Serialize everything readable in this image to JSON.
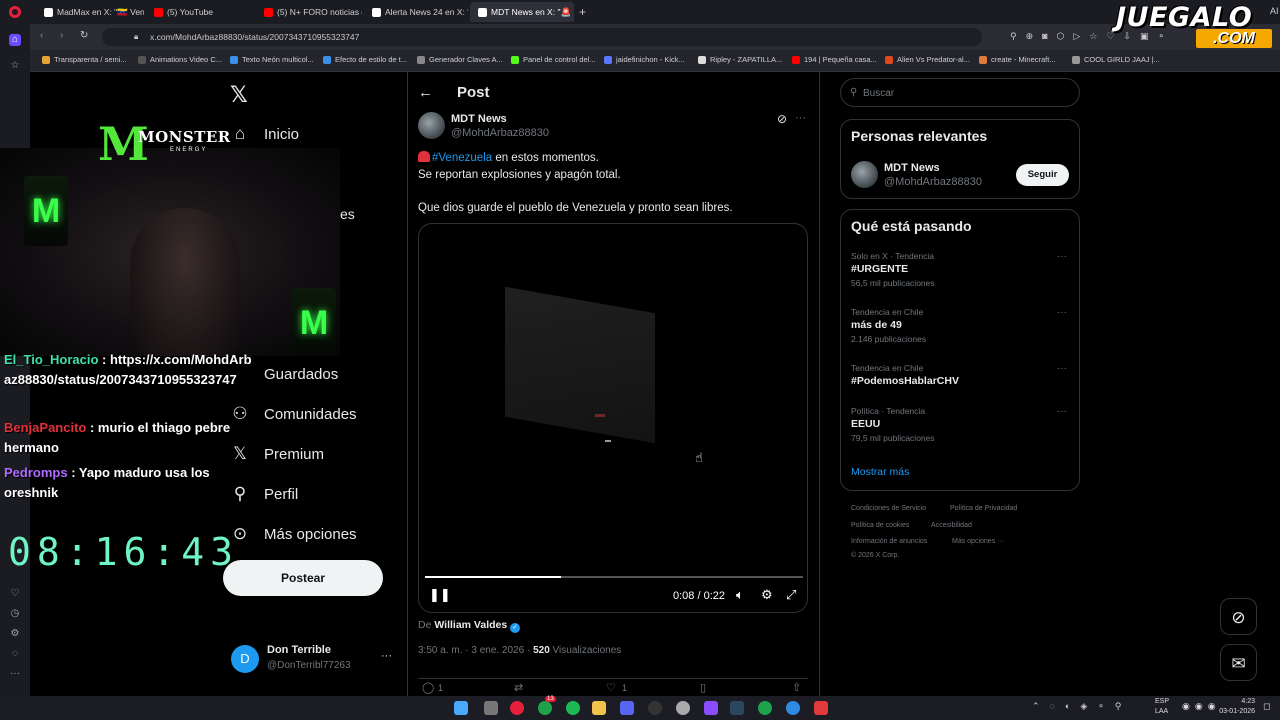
{
  "browser": {
    "tabs": [
      {
        "label": "MadMax en X: \"🇻🇪 Vene",
        "color": "#ffffff"
      },
      {
        "label": "(5) YouTube",
        "color": "#ff0000"
      },
      {
        "label": "(5) N+ FORO noticias en v",
        "color": "#ff0000"
      },
      {
        "label": "Alerta News 24 en X: \"úut",
        "color": "#ffffff"
      },
      {
        "label": "MDT News en X: \"🚨",
        "color": "#ffffff"
      }
    ],
    "url": "x.com/MohdArbaz88830/status/2007343710955323747",
    "bookmarks": [
      "Transparenta / semi...",
      "Animations Video C...",
      "Texto Neón multicol...",
      "Efecto de estilo de t...",
      "Generador Claves A...",
      "Panel de control del...",
      "jaidefinichon - Kick...",
      "Ripley - ZAPATILLA...",
      "194 | Pequeña casa...",
      "Alien Vs Predator-al...",
      "create - Minecraft...",
      "COOL GIRLD JAAJ |..."
    ]
  },
  "overlay": {
    "logo_main": "JUEGALO",
    "logo_sub": ".COM",
    "monster_word": "MONSTER",
    "energy_word": "ENERGY",
    "chat": [
      {
        "user": "El_Tio_Horacio",
        "user_color": "#3fe0a8",
        "text": " : https://x.com/MohdArbaz88830/status/2007343710955323747"
      },
      {
        "user": "BenjaPancito",
        "user_color": "#e0303a",
        "text": " : murio el thiago pebre hermano"
      },
      {
        "user": "Pedromps",
        "user_color": "#b06bff",
        "text": " : Yapo maduro usa los oreshnik"
      }
    ],
    "timer": "08:16:43"
  },
  "nav": {
    "home": "Inicio",
    "partial": "es",
    "saved": "Guardados",
    "communities": "Comunidades",
    "premium": "Premium",
    "profile": "Perfil",
    "more": "Más opciones",
    "post_button": "Postear",
    "account_name": "Don Terrible",
    "account_handle": "@DonTerribl77263"
  },
  "post": {
    "header": "Post",
    "author_name": "MDT News",
    "author_handle": "@MohdArbaz88830",
    "line1_hashtag": "#Venezuela",
    "line1_rest": " en estos momentos.",
    "line2": "Se reportan explosiones y apagón total.",
    "line3": "Que dios guarde el pueblo de Venezuela y pronto sean libres.",
    "video_time": "0:08 / 0:22",
    "video_progress": 0.36,
    "source_prefix": "De ",
    "source_name": "William Valdes",
    "timestamp": "3:50 a. m. · 3 ene. 2026 · ",
    "views_count": "520",
    "views_label": " Visualizaciones",
    "reply_count": "1",
    "like_count": "1"
  },
  "sidebar": {
    "search_placeholder": "Buscar",
    "relevant_title": "Personas relevantes",
    "relevant_name": "MDT News",
    "relevant_handle": "@MohdArbaz88830",
    "follow_label": "Seguir",
    "trending_title": "Qué está pasando",
    "trends": [
      {
        "context": "Solo en X · Tendencia",
        "name": "#URGENTE",
        "count": "56,5 mil publicaciones"
      },
      {
        "context": "Tendencia en Chile",
        "name": "más de 49",
        "count": "2.146 publicaciones"
      },
      {
        "context": "Tendencia en Chile",
        "name": "#PodemosHablarCHV",
        "count": ""
      },
      {
        "context": "Política · Tendencia",
        "name": "EEUU",
        "count": "79,5 mil publicaciones"
      }
    ],
    "show_more": "Mostrar más",
    "footer": {
      "terms": "Condiciones de Servicio",
      "privacy": "Política de Privacidad",
      "cookies": "Política de cookies",
      "accessibility": "Accesibilidad",
      "ads": "Información de anuncios",
      "more": "Más opciones ···",
      "copyright": "© 2026 X Corp."
    }
  },
  "taskbar": {
    "lang": "ESP",
    "lang2": "LAA",
    "time": "4:23",
    "date": "03-01-2026",
    "badge": "13"
  },
  "colors": {
    "accent": "#1d9bf0",
    "border": "#2f3336",
    "muted": "#71767b"
  }
}
